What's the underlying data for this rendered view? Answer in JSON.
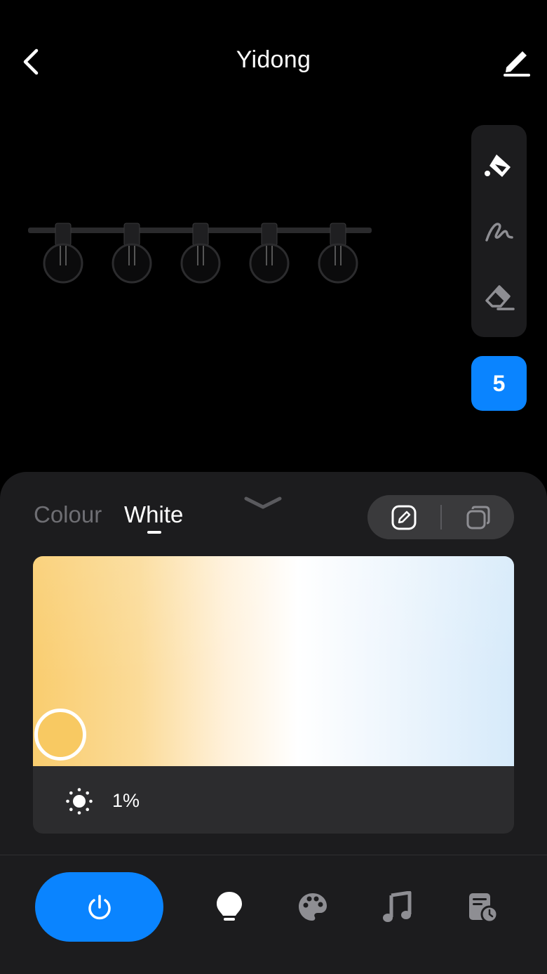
{
  "header": {
    "title": "Yidong",
    "back_icon": "chevron-left-icon",
    "edit_icon": "pencil-icon"
  },
  "canvas": {
    "bulb_count": 5,
    "tools": [
      {
        "name": "paint-bucket-icon",
        "state": "active"
      },
      {
        "name": "brush-icon",
        "state": "inactive"
      },
      {
        "name": "eraser-icon",
        "state": "inactive"
      }
    ],
    "selected_count": "5"
  },
  "panel": {
    "tabs": [
      {
        "label": "Colour",
        "active": false
      },
      {
        "label": "White",
        "active": true
      }
    ],
    "collapse_icon": "chevron-down-icon",
    "mode_toggle": [
      {
        "name": "edit-mode-icon",
        "active": true
      },
      {
        "name": "copy-mode-icon",
        "active": false
      }
    ],
    "white_picker": {
      "warm_color": "#f9cd6f",
      "cool_color": "#d6eafa",
      "thumb_color": "#f8c962"
    },
    "brightness": {
      "icon": "sun-icon",
      "value": "1%"
    }
  },
  "bottom_nav": {
    "power_icon": "power-icon",
    "items": [
      "bulb-icon",
      "palette-icon",
      "music-icon",
      "schedule-icon"
    ]
  },
  "colors": {
    "accent": "#0a84ff",
    "background": "#000000",
    "panel": "#1c1c1e"
  }
}
